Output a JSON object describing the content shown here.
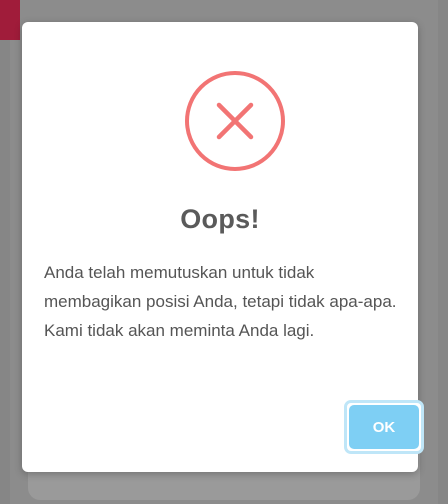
{
  "dialog": {
    "title": "Oops!",
    "message": "Anda telah memutuskan untuk tidak membagikan posisi Anda, tetapi tidak apa-apa. Kami tidak akan meminta Anda lagi.",
    "ok_label": "OK",
    "icon": "error-x-circle-icon"
  },
  "colors": {
    "error_icon": "#f27474",
    "ok_button": "#7ecff4",
    "ok_button_ring": "#bfe6f8",
    "backdrop_accent": "#a01c3a"
  }
}
